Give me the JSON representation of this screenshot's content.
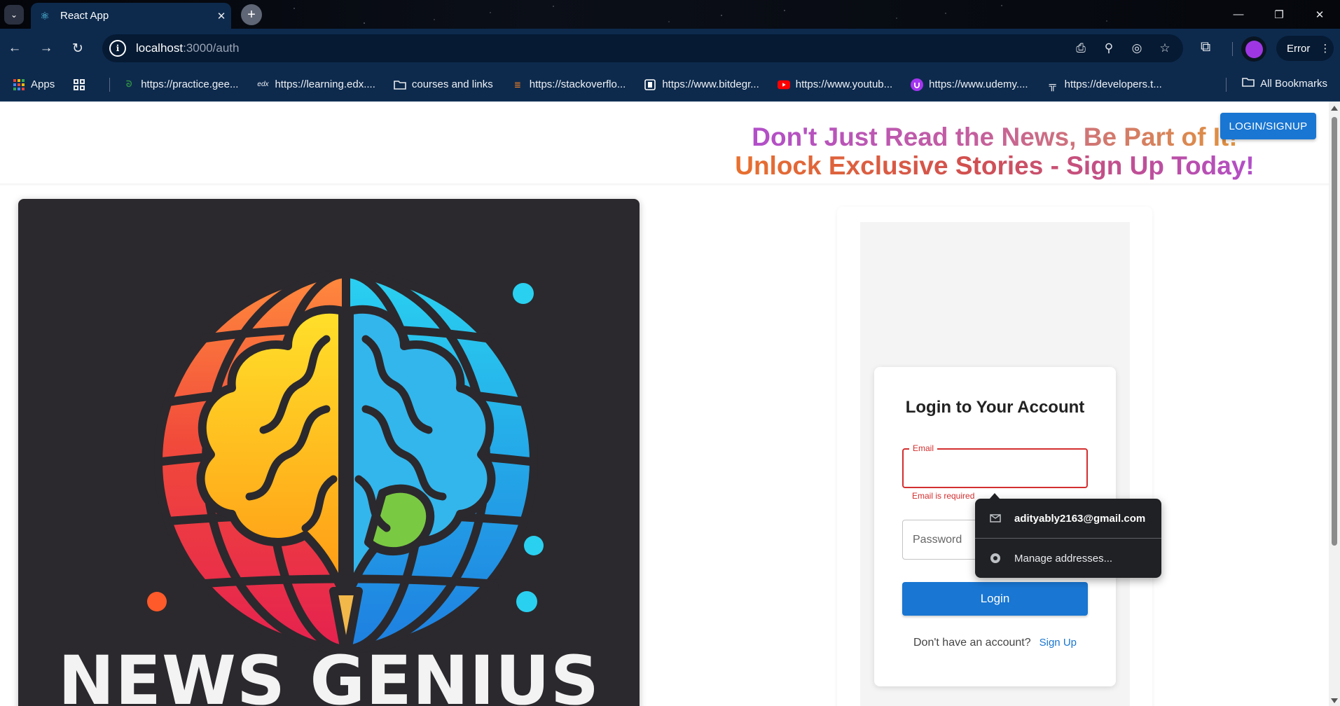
{
  "browser": {
    "tab_title": "React App",
    "new_tab_symbol": "+",
    "url_host": "localhost",
    "url_path": ":3000/auth",
    "error_chip": "Error",
    "bookmarks": [
      {
        "label": "Apps",
        "icon": "apps-grid-icon"
      },
      {
        "label": "https://practice.gee...",
        "icon": "gfg-icon"
      },
      {
        "label": "https://learning.edx....",
        "icon": "edx-icon"
      },
      {
        "label": "courses and links",
        "icon": "folder-icon"
      },
      {
        "label": "https://stackoverflo...",
        "icon": "stackoverflow-icon"
      },
      {
        "label": "https://www.bitdegr...",
        "icon": "bitdegree-icon"
      },
      {
        "label": "https://www.youtub...",
        "icon": "youtube-icon"
      },
      {
        "label": "https://www.udemy....",
        "icon": "udemy-icon"
      },
      {
        "label": "https://developers.t...",
        "icon": "developers-icon"
      }
    ],
    "all_bookmarks": "All Bookmarks"
  },
  "page": {
    "auth_button": "LOGIN/SIGNUP",
    "headline_line1": "Don't Just Read the News, Be Part of It!",
    "headline_line2": "Unlock Exclusive Stories - Sign Up Today!",
    "logo_text": "NEWS GENIUS",
    "login": {
      "title": "Login to Your Account",
      "email_label": "Email",
      "email_helper": "Email is required",
      "password_placeholder": "Password",
      "login_button": "Login",
      "signup_prompt": "Don't have an account?",
      "signup_link": "Sign Up"
    },
    "autofill": {
      "suggestion": "adityably2163@gmail.com",
      "manage": "Manage addresses..."
    }
  },
  "colors": {
    "primary": "#1976d2",
    "error": "#d32f2f",
    "chrome_toolbar": "#0d2a4d",
    "logo_bg": "#2b292d"
  }
}
